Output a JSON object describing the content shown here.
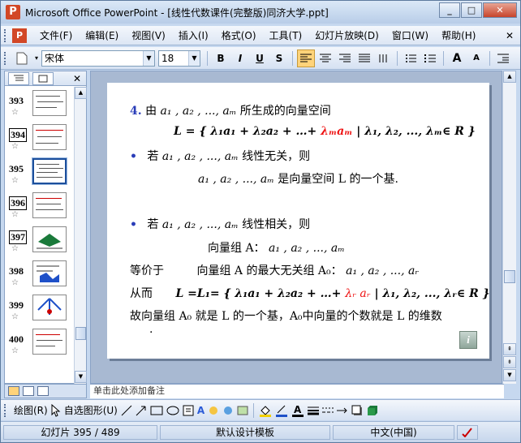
{
  "window": {
    "title": "Microsoft Office PowerPoint - [线性代数课件(完整版)同济大学.ppt]",
    "app_icon_text": "P",
    "minimize": "_",
    "maximize": "□",
    "close": "✕"
  },
  "menu": {
    "items": [
      "文件(F)",
      "编辑(E)",
      "视图(V)",
      "插入(I)",
      "格式(O)",
      "工具(T)",
      "幻灯片放映(D)",
      "窗口(W)",
      "帮助(H)"
    ],
    "close": "✕"
  },
  "format_toolbar": {
    "font": "宋体",
    "size": "18",
    "bold": "B",
    "italic": "I",
    "underline": "U",
    "shadow": "S",
    "grow": "A",
    "shrink": "A"
  },
  "slides_pane": {
    "close": "✕",
    "thumbnails": [
      {
        "number": "393",
        "star": "☆"
      },
      {
        "number": "394",
        "star": "☆"
      },
      {
        "number": "395",
        "star": "☆"
      },
      {
        "number": "396",
        "star": "☆"
      },
      {
        "number": "397",
        "star": "☆"
      },
      {
        "number": "398",
        "star": "☆"
      },
      {
        "number": "399",
        "star": "☆"
      },
      {
        "number": "400",
        "star": "☆"
      }
    ]
  },
  "slide": {
    "line1_num": "4.",
    "line1_pre": "由",
    "line1_vars": "a₁ , a₂ , ..., aₘ",
    "line1_post": "所生成的向量空间",
    "line2": "L = { λ₁a₁ + λ₂a₂ + …+ ",
    "line2_red": "λₘaₘ",
    "line2_post": " | λ₁, λ₂, ..., λₘ∈ R }",
    "line3_bullet": "•",
    "line3_pre": "若",
    "line3_vars": "a₁ , a₂ , ..., aₘ",
    "line3_post": "线性无关，则",
    "line4_vars": "a₁ , a₂ , ..., aₘ",
    "line4_post": "是向量空间 L 的一个基.",
    "line5_bullet": "•",
    "line5_pre": "若",
    "line5_vars": "a₁ , a₂ , ..., aₘ",
    "line5_post": "线性相关，则",
    "line6_pre": "向量组 A：",
    "line6_vars": "a₁ , a₂ , ..., aₘ",
    "line7_pre": "等价于",
    "line7_mid": "向量组 A 的最大无关组 A₀：",
    "line7_vars": "a₁ , a₂ , ..., aᵣ",
    "line8_pre": "从而",
    "line8_a": "L =L₁= { λ₁a₁ + λ₂a₂ + …+ ",
    "line8_red": "λᵣ aᵣ",
    "line8_b": " | λ₁, λ₂, ..., λᵣ∈ R }",
    "line9": "故向量组 A₀ 就是 L 的一个基，A₀中向量的个数就是 L 的维数",
    "line10": ".",
    "info_icon": "i"
  },
  "notes_placeholder": "单击此处添加备注",
  "draw_toolbar": {
    "draw": "绘图(R)",
    "autoshapes": "自选图形(U)"
  },
  "status": {
    "slide": "幻灯片 395 / 489",
    "template": "默认设计模板",
    "language": "中文(中国)"
  }
}
